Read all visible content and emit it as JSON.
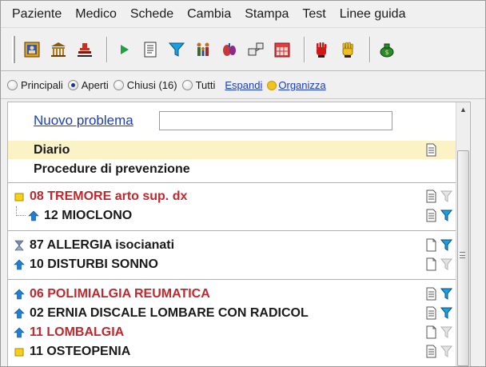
{
  "menu": {
    "items": [
      "Paziente",
      "Medico",
      "Schede",
      "Cambia",
      "Stampa",
      "Test",
      "Linee guida"
    ]
  },
  "toolbar": {
    "buttons": [
      {
        "icon": "patient-card-icon"
      },
      {
        "icon": "bank-icon"
      },
      {
        "icon": "stamp-icon"
      },
      {
        "icon": "play-icon"
      },
      {
        "icon": "list-document-icon"
      },
      {
        "icon": "filter-icon"
      },
      {
        "icon": "family-icon"
      },
      {
        "icon": "organs-icon"
      },
      {
        "icon": "network-icon"
      },
      {
        "icon": "calendar-icon"
      },
      {
        "icon": "red-hand-icon"
      },
      {
        "icon": "yellow-hand-icon"
      },
      {
        "icon": "money-bag-icon"
      }
    ]
  },
  "filters": {
    "options": [
      {
        "label": "Principali",
        "checked": false
      },
      {
        "label": "Aperti",
        "checked": true
      },
      {
        "label": "Chiusi (16)",
        "checked": false
      },
      {
        "label": "Tutti",
        "checked": false
      }
    ],
    "expand_label": "Espandi",
    "organize_label": "Organizza"
  },
  "panel": {
    "new_problem_label": "Nuovo problema",
    "new_problem_value": "",
    "rows": [
      {
        "label": "Diario",
        "style": "diario",
        "lead_icon": "",
        "doc_icon": "document-lines-icon",
        "filter_icon": ""
      },
      {
        "label": "Procedure di prevenzione",
        "style": "plain",
        "lead_icon": "",
        "doc_icon": "",
        "filter_icon": ""
      },
      {
        "label": "08 TREMORE arto sup. dx",
        "style": "red",
        "lead_icon": "yellow-square-icon",
        "doc_icon": "document-lines-icon",
        "filter_icon": "filter-grey-icon"
      },
      {
        "label": "12 MIOCLONO",
        "style": "plain",
        "lead_icon": "blue-up-arrow-icon",
        "doc_icon": "document-lines-icon",
        "filter_icon": "filter-blue-icon",
        "child": true
      },
      {
        "label": "87 ALLERGIA isocianati",
        "style": "plain",
        "lead_icon": "hourglass-icon",
        "doc_icon": "document-blank-icon",
        "filter_icon": "filter-blue-icon"
      },
      {
        "label": "10 DISTURBI SONNO",
        "style": "plain",
        "lead_icon": "blue-up-arrow-icon",
        "doc_icon": "document-blank-icon",
        "filter_icon": "filter-grey-icon"
      },
      {
        "label": "06 POLIMIALGIA REUMATICA",
        "style": "red",
        "lead_icon": "blue-up-arrow-icon",
        "doc_icon": "document-lines-icon",
        "filter_icon": "filter-blue-icon"
      },
      {
        "label": "02 ERNIA DISCALE LOMBARE CON RADICOL",
        "style": "plain",
        "lead_icon": "blue-up-arrow-icon",
        "doc_icon": "document-lines-icon",
        "filter_icon": "filter-blue-icon"
      },
      {
        "label": "11 LOMBALGIA",
        "style": "red",
        "lead_icon": "blue-up-arrow-icon",
        "doc_icon": "document-blank-icon",
        "filter_icon": "filter-grey-icon"
      },
      {
        "label": "11 OSTEOPENIA",
        "style": "plain",
        "lead_icon": "yellow-square-icon",
        "doc_icon": "document-lines-icon",
        "filter_icon": "filter-grey-icon"
      }
    ]
  }
}
